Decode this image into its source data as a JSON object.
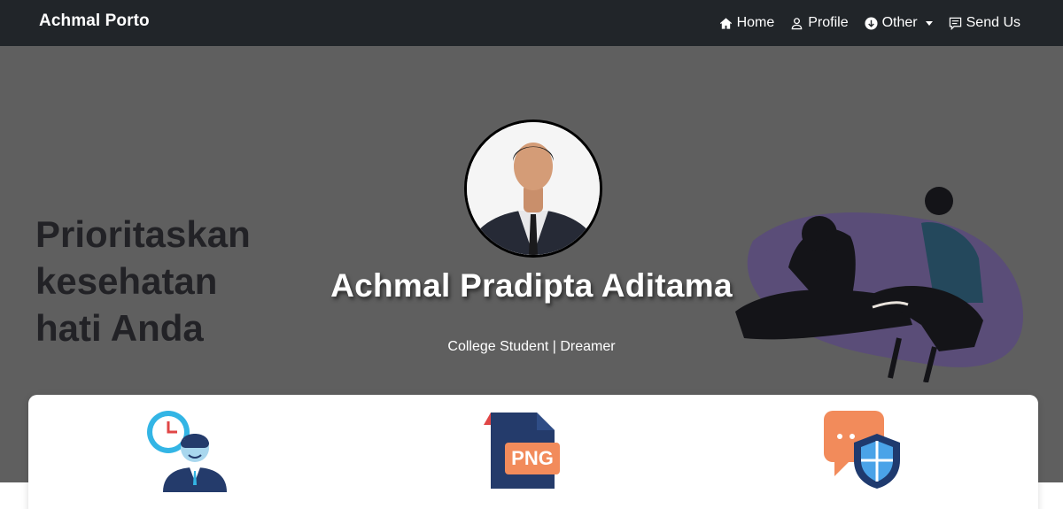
{
  "navbar": {
    "brand": "Achmal Porto",
    "items": [
      {
        "label": "Home",
        "icon": "house-icon"
      },
      {
        "label": "Profile",
        "icon": "person-icon"
      },
      {
        "label": "Other",
        "icon": "arrow-down-circle-icon",
        "dropdown": true
      },
      {
        "label": "Send Us",
        "icon": "chat-square-text-icon"
      }
    ]
  },
  "hero": {
    "background_text": [
      "Prioritaskan",
      "kesehatan",
      "hati Anda"
    ],
    "name": "Achmal Pradipta Aditama",
    "tagline": "College Student | Dreamer",
    "avatar_icon": "profile-photo"
  },
  "features": [
    {
      "icon": "time-management-person-icon"
    },
    {
      "icon": "png-file-icon",
      "badge": "PNG"
    },
    {
      "icon": "secure-chat-shield-icon"
    }
  ],
  "colors": {
    "navbar_bg": "#212529",
    "hero_bg": "#5f5f5f",
    "accent_purple": "#6e5a9c",
    "png_orange": "#f28b5b",
    "shield_blue": "#1f3a6e"
  }
}
